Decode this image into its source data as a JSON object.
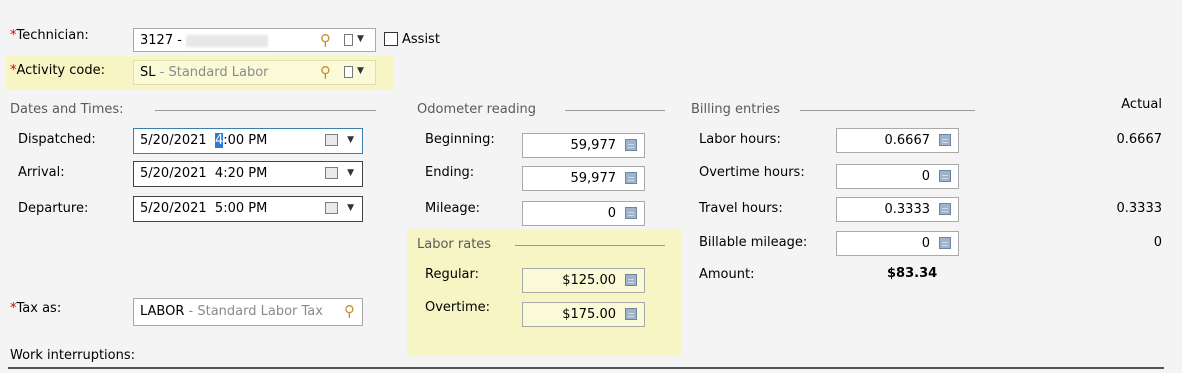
{
  "technician": {
    "label": "Technician:",
    "required_mark": "*",
    "value_code": "3127 -",
    "assist_label": "Assist"
  },
  "activity": {
    "label": "Activity code:",
    "required_mark": "*",
    "code": "SL",
    "description": "- Standard Labor"
  },
  "dates": {
    "title": "Dates and Times:",
    "dispatched": {
      "label": "Dispatched:",
      "date": "5/20/2021",
      "time_sel": "4",
      "time_rest": ":00 PM"
    },
    "arrival": {
      "label": "Arrival:",
      "value": "5/20/2021  4:20 PM"
    },
    "departure": {
      "label": "Departure:",
      "value": "5/20/2021  5:00 PM"
    }
  },
  "odometer": {
    "title": "Odometer reading",
    "beginning": {
      "label": "Beginning:",
      "value": "59,977"
    },
    "ending": {
      "label": "Ending:",
      "value": "59,977"
    },
    "mileage": {
      "label": "Mileage:",
      "value": "0"
    }
  },
  "labor_rates": {
    "title": "Labor rates",
    "regular": {
      "label": "Regular:",
      "value": "$125.00"
    },
    "overtime": {
      "label": "Overtime:",
      "value": "$175.00"
    }
  },
  "billing": {
    "title": "Billing entries",
    "actual_header": "Actual",
    "labor_hours": {
      "label": "Labor hours:",
      "value": "0.6667",
      "actual": "0.6667"
    },
    "overtime_hours": {
      "label": "Overtime hours:",
      "value": "0"
    },
    "travel_hours": {
      "label": "Travel hours:",
      "value": "0.3333",
      "actual": "0.3333"
    },
    "billable_mileage": {
      "label": "Billable mileage:",
      "value": "0",
      "actual": "0"
    },
    "amount": {
      "label": "Amount:",
      "value": "$83.34"
    }
  },
  "tax": {
    "label": "Tax as:",
    "required_mark": "*",
    "code": "LABOR",
    "description": "- Standard Labor Tax"
  },
  "work_interruptions": {
    "label": "Work interruptions:"
  },
  "colors": {
    "highlight": "#f7f5c4",
    "required": "#d40000",
    "selection": "#2f7ad8"
  },
  "icons": [
    "search-icon",
    "document-icon",
    "calendar-icon",
    "calculator-icon",
    "chevron-down-icon"
  ]
}
